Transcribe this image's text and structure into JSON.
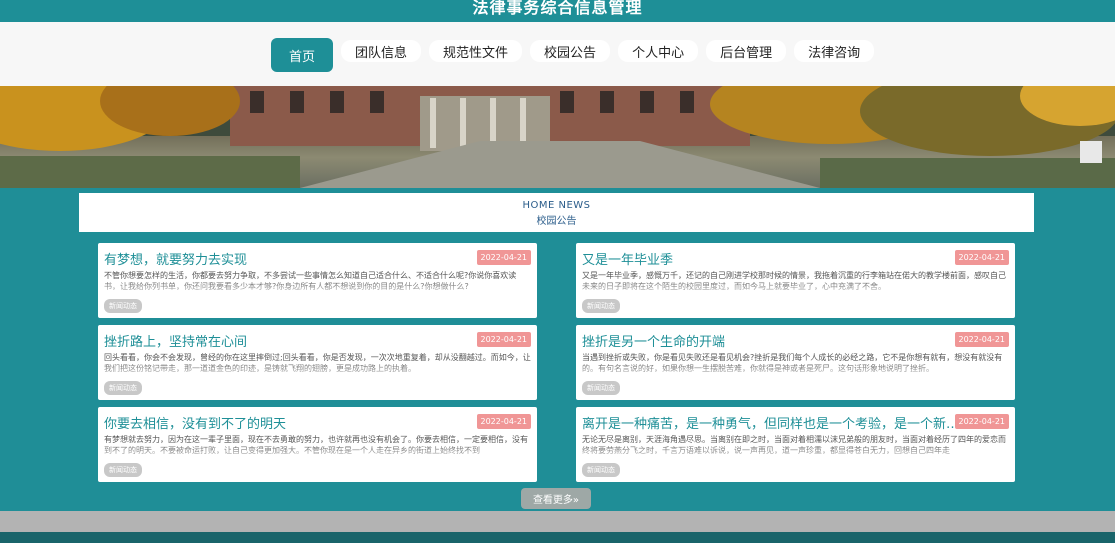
{
  "header": {
    "title": "法律事务综合信息管理"
  },
  "nav": {
    "items": [
      {
        "label": "首页",
        "active": true
      },
      {
        "label": "团队信息"
      },
      {
        "label": "规范性文件"
      },
      {
        "label": "校园公告"
      },
      {
        "label": "个人中心"
      },
      {
        "label": "后台管理"
      },
      {
        "label": "法律咨询"
      }
    ]
  },
  "section": {
    "en": "HOME NEWS",
    "cn": "校园公告"
  },
  "news": [
    {
      "title": "有梦想，就要努力去实现",
      "date": "2022-04-21",
      "text": "不管你想要怎样的生活，你都要去努力争取，不多尝试一些事情怎么知道自己适合什么、不适合什么呢?你说你喜欢读书，让我给你列书单，你还问我要看多少本才够?你身边所有人都不想说到你的目的是什么?你想做什么?",
      "tag": "新闻动态"
    },
    {
      "title": "又是一年毕业季",
      "date": "2022-04-21",
      "text": "又是一年毕业季，感慨万千，还记的自己刚进学校那时候的情景，我拖着沉重的行李箱站在偌大的教学楼前面，感叹自己未来的日子即将在这个陌生的校园里度过，而如今马上就要毕业了，心中充满了不舍。",
      "tag": "新闻动态"
    },
    {
      "title": "挫折路上，坚持常在心间",
      "date": "2022-04-21",
      "text": "回头看看，你会不会发现，曾经的你在这里摔倒过;回头看看，你是否发现，一次次地重复着，却从没翻越过。而如今，让我们把这份铭记带走，那一道道金色的印迹，是铸就飞翔的翅膀，更是成功路上的执着。",
      "tag": "新闻动态"
    },
    {
      "title": "挫折是另一个生命的开端",
      "date": "2022-04-21",
      "text": "当遇到挫折或失败，你是看见失败还是看见机会?挫折是我们每个人成长的必经之路，它不是你想有就有，想没有就没有的。有句名言说的好，如果你想一生摆脱苦难，你就得是神或者是死尸。这句话形象地说明了挫折。",
      "tag": "新闻动态"
    },
    {
      "title": "你要去相信，没有到不了的明天",
      "date": "2022-04-21",
      "text": "有梦想就去努力，因为在这一辈子里面，现在不去勇敢的努力，也许就再也没有机会了。你要去相信，一定要相信，没有到不了的明天。不要被命运打败，让自己变得更加强大。不管你现在是一个人走在异乡的街道上始终找不到",
      "tag": "新闻动态"
    },
    {
      "title": "离开是一种痛苦，是一种勇气，但同样也是一个考验，是一个新的开始",
      "date": "2022-04-21",
      "text": "无论无尽是离别，天涯海角遇尽思。当离别在即之时，当面对着相濡以沫兄弟般的朋友时，当面对着经历了四年的爱恋而终将要劳燕分飞之时，千言万语难以诉说，说一声再见，道一声珍重，都显得苍白无力，回想自己四年走",
      "tag": "新闻动态"
    }
  ],
  "more_button": "查看更多»"
}
